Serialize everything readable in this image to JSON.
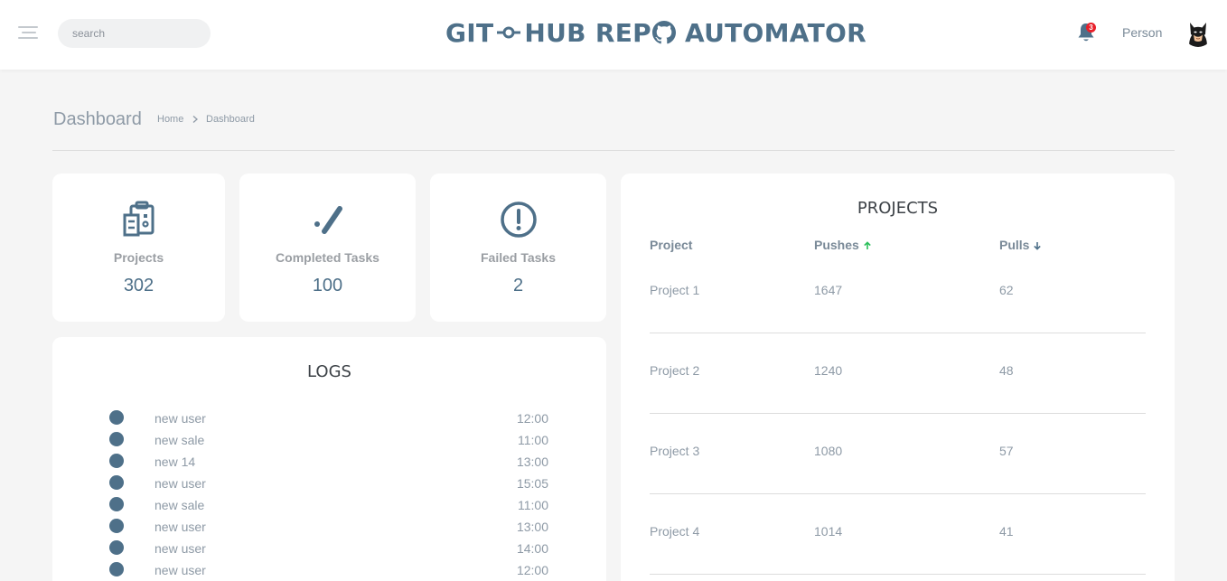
{
  "header": {
    "search_placeholder": "search",
    "title_parts": [
      "GIT",
      "HUB REP",
      "AUTOMATOR"
    ],
    "notification_count": "3",
    "user_name": "Person"
  },
  "breadcrumb": {
    "page_title": "Dashboard",
    "home": "Home",
    "current": "Dashboard"
  },
  "stats": [
    {
      "label": "Projects",
      "value": "302",
      "icon": "clipboard-building-icon"
    },
    {
      "label": "Completed Tasks",
      "value": "100",
      "icon": "check-slash-icon"
    },
    {
      "label": "Failed Tasks",
      "value": "2",
      "icon": "exclamation-circle-icon"
    }
  ],
  "logs": {
    "title": "LOGS",
    "items": [
      {
        "text": "new user",
        "time": "12:00"
      },
      {
        "text": "new sale",
        "time": "11:00"
      },
      {
        "text": "new 14",
        "time": "13:00"
      },
      {
        "text": "new user",
        "time": "15:05"
      },
      {
        "text": "new sale",
        "time": "11:00"
      },
      {
        "text": "new user",
        "time": "13:00"
      },
      {
        "text": "new user",
        "time": "14:00"
      },
      {
        "text": "new user",
        "time": "12:00"
      }
    ]
  },
  "projects": {
    "title": "PROJECTS",
    "columns": [
      "Project",
      "Pushes",
      "Pulls"
    ],
    "rows": [
      {
        "name": "Project 1",
        "pushes": "1647",
        "pulls": "62"
      },
      {
        "name": "Project 2",
        "pushes": "1240",
        "pulls": "48"
      },
      {
        "name": "Project 3",
        "pushes": "1080",
        "pulls": "57"
      },
      {
        "name": "Project 4",
        "pushes": "1014",
        "pulls": "41"
      }
    ]
  },
  "colors": {
    "accent": "#4e7089",
    "sort_up": "#2bbf5a",
    "badge": "#e8202a",
    "background": "#f5f5f5"
  }
}
